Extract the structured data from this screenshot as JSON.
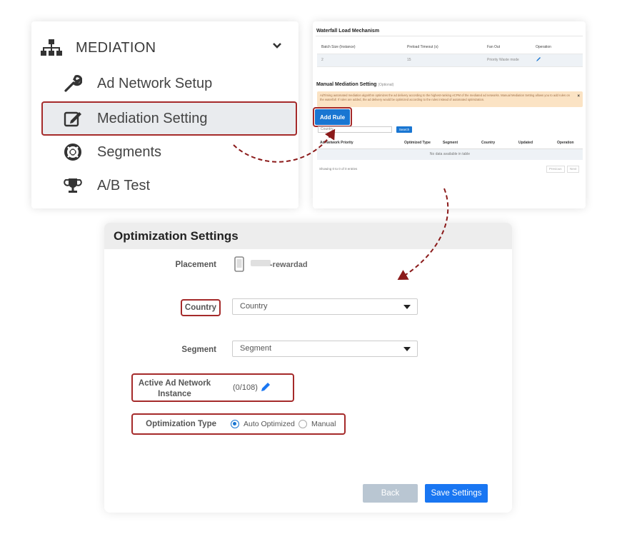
{
  "sidebar": {
    "header_label": "MEDIATION",
    "items": [
      {
        "label": "Ad Network Setup",
        "icon": "wrench-icon"
      },
      {
        "label": "Mediation Setting",
        "icon": "edit-icon"
      },
      {
        "label": "Segments",
        "icon": "lifebuoy-icon"
      },
      {
        "label": "A/B Test",
        "icon": "trophy-icon"
      }
    ]
  },
  "mediation_panel": {
    "waterfall_title": "Waterfall Load Mechanism",
    "waterfall_headers": [
      "Batch Size (Instance)",
      "Preload Timeout (s)",
      "Fan Out",
      "Operation"
    ],
    "waterfall_row": [
      "2",
      "15",
      "Priority Waste mode"
    ],
    "manual_title": "Manual Mediation Setting",
    "manual_optional": "(Optional)",
    "alert_text": "AdTiming automated mediation algorithm optimizes the ad delivery according to the highest-ranking eCPM of the mediated ad networks. Manual Mediation Setting allows you to add rules on the waterfall. If rules are added, the ad delivery would be optimized according to the rules instead of automated optimization.",
    "alert_close": "×",
    "add_rule_label": "Add Rule",
    "country_placeholder": "Country",
    "search_label": "Search",
    "rules_headers": [
      "Ad Network Priority",
      "Optimized Type",
      "Segment",
      "Country",
      "Updated",
      "Operation"
    ],
    "empty_text": "No data available in table",
    "showing_text": "Showing 0 to 0 of 0 entries",
    "prev_label": "Previous",
    "next_label": "Next"
  },
  "optimization": {
    "title": "Optimization Settings",
    "placement_label": "Placement",
    "placement_value": "-rewardad",
    "country_label": "Country",
    "country_value": "Country",
    "segment_label": "Segment",
    "segment_value": "Segment",
    "active_label_line1": "Active Ad Network",
    "active_label_line2": "Instance",
    "active_value": "(0/108)",
    "opt_type_label": "Optimization Type",
    "opt_auto": "Auto Optimized",
    "opt_manual": "Manual",
    "selected_option": "Auto Optimized",
    "back_label": "Back",
    "save_label": "Save Settings"
  },
  "colors": {
    "highlight": "#a52a2a",
    "primary": "#1976f2",
    "back_button": "#b9c6d2",
    "alert_bg": "#fbe3c4"
  }
}
